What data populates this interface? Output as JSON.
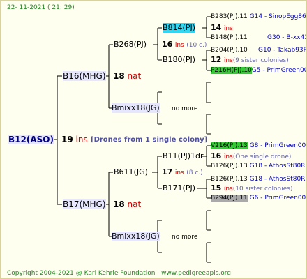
{
  "header": {
    "date": "22- 11-2021 ( 21: 29)"
  },
  "footer": {
    "copyright": "Copyright 2004-2021 @ Karl Kehrle Foundation",
    "site": "www.pedigreeapis.org"
  },
  "root": {
    "name": "B12(ASO)",
    "gen": "19",
    "unit": "ins",
    "note": "[Drones from 1 single colony]"
  },
  "mother": {
    "name": "B16(MHG)",
    "gen": "18",
    "unit": "nat"
  },
  "sire": {
    "name": "B17(MHG)",
    "gen": "18",
    "unit": "nat"
  },
  "mm": {
    "name": "B268(PJ)",
    "gen": "16",
    "unit": "ins",
    "extra": "(10 c.)"
  },
  "mmm": {
    "name": "B814(PJ)",
    "gen": "14",
    "unit": "ins"
  },
  "mmmm": {
    "name": "B283(PJ).11",
    "tag": "G14 - SinopEgg86R"
  },
  "mmmf": {
    "name": "B148(PJ).11",
    "tag": "G30 - B-xx43"
  },
  "mmf": {
    "name": "B180(PJ)",
    "gen": "12",
    "unit": "ins",
    "extra": "(9 sister colonies)"
  },
  "mmfm": {
    "name": "B204(PJ).10",
    "tag": "G10 - Takab93R"
  },
  "mmff": {
    "name": "P216H(PJ).10",
    "tag": "G5 - PrimGreen00"
  },
  "mf": {
    "name": "Bmixx18(JG)",
    "more": "no more"
  },
  "fm": {
    "name": "B611(JG)",
    "gen": "17",
    "unit": "ins",
    "extra": "(8 c.)"
  },
  "fmm": {
    "name": "B11(PJ)1dr",
    "gen": "16",
    "unit": "ins",
    "extra": "(One single drone)"
  },
  "fmmm": {
    "name": "V216(PJ).13",
    "tag": "G8 - PrimGreen00"
  },
  "fmmf": {
    "name": "B126(PJ).13",
    "tag": "G18 - AthosSt80R"
  },
  "fmf": {
    "name": "B171(PJ)",
    "gen": "15",
    "unit": "ins",
    "extra": "(10 sister colonies)"
  },
  "fmfm": {
    "name": "B126(PJ).13",
    "tag": "G18 - AthosSt80R"
  },
  "fmff": {
    "name": "B294(PJ).11",
    "tag": "G6 - PrimGreen00"
  },
  "ff": {
    "name": "Bmixx18(JG)",
    "more": "no more"
  }
}
